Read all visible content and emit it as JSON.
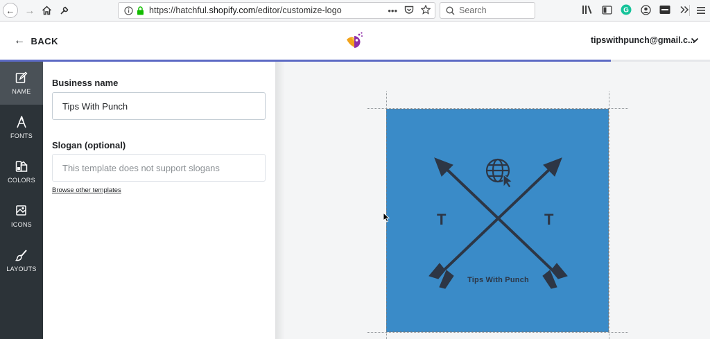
{
  "browser": {
    "url_prefix": "https://hatchful.",
    "url_domain": "shopify.com",
    "url_path": "/editor/customize-logo",
    "search_placeholder": "Search",
    "url_actions_more": "•••"
  },
  "header": {
    "back_label": "BACK",
    "account_email": "tipswithpunch@gmail.c...",
    "progress_fraction": 0.86
  },
  "sidebar": {
    "items": [
      {
        "label": "NAME",
        "icon": "edit-icon",
        "active": true
      },
      {
        "label": "FONTS",
        "icon": "font-icon",
        "active": false
      },
      {
        "label": "COLORS",
        "icon": "palette-icon",
        "active": false
      },
      {
        "label": "ICONS",
        "icon": "shapes-icon",
        "active": false
      },
      {
        "label": "LAYOUTS",
        "icon": "brush-icon",
        "active": false
      }
    ]
  },
  "form": {
    "business_name_label": "Business name",
    "business_name_value": "Tips With Punch",
    "slogan_label": "Slogan (optional)",
    "slogan_placeholder": "This template does not support slogans",
    "browse_link": "Browse other templates"
  },
  "logo": {
    "background_color": "#3a8bc8",
    "foreground_color": "#2d3645",
    "left_letter": "T",
    "right_letter": "T",
    "tagline": "Tips With Punch",
    "center_icon": "globe-cursor-icon"
  },
  "colors": {
    "accent": "#5c6ac4",
    "sidebar_bg": "#2c3338"
  }
}
